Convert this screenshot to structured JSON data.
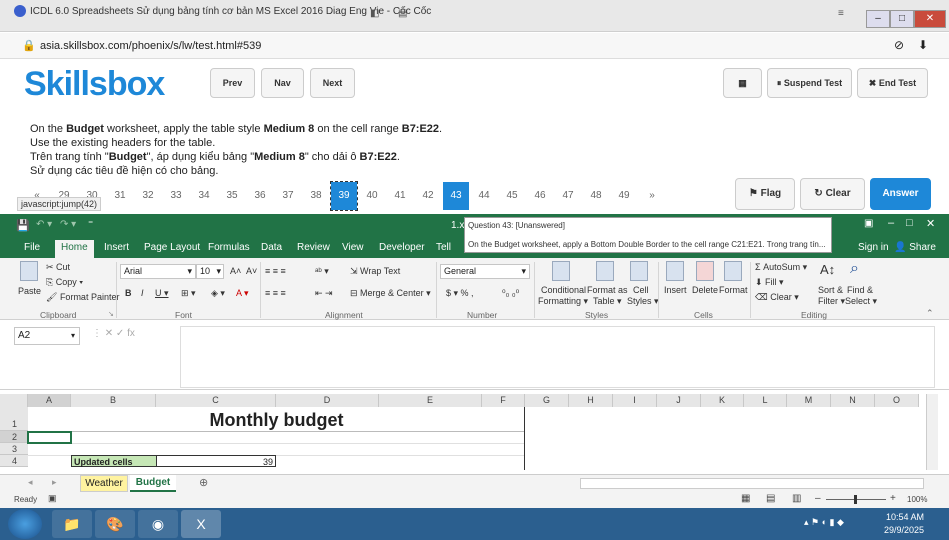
{
  "browser": {
    "title": "ICDL 6.0 Spreadsheets Sử dụng bảng tính cơ bản MS Excel 2016 Diag Eng Vie - Cốc Cốc",
    "url": "asia.skillsbox.com/phoenix/s/lw/test.html#539",
    "status_tip": "javascript:jump(42)"
  },
  "skillsbox": {
    "logo": "Skillsbox",
    "prev": "Prev",
    "nav": "Nav",
    "next": "Next",
    "suspend": "Suspend Test",
    "end": "End Test"
  },
  "question": {
    "en_line1_a": "On the ",
    "en_line1_b": "Budget",
    "en_line1_c": " worksheet, apply the table style ",
    "en_line1_d": "Medium 8",
    "en_line1_e": " on the cell range ",
    "en_line1_f": "B7:E22",
    "en_line1_g": ".",
    "en_line2": "Use the existing headers for the table.",
    "vi_line1_a": "Trên trang tính \"",
    "vi_line1_b": "Budget",
    "vi_line1_c": "\", áp dụng kiểu bảng \"",
    "vi_line1_d": "Medium 8",
    "vi_line1_e": "\" cho dải ô ",
    "vi_line1_f": "B7:E22",
    "vi_line1_g": ".",
    "vi_line2": "Sử dụng các tiêu đề hiện có cho bảng."
  },
  "pager": {
    "pages": [
      "«",
      "29",
      "30",
      "31",
      "32",
      "33",
      "34",
      "35",
      "36",
      "37",
      "38",
      "39",
      "40",
      "41",
      "42",
      "43",
      "44",
      "45",
      "46",
      "47",
      "48",
      "49",
      "»"
    ],
    "flag": "Flag",
    "clear": "Clear",
    "answer": "Answer"
  },
  "excel": {
    "filename": "1.xl",
    "tabs": [
      "File",
      "Home",
      "Insert",
      "Page Layout",
      "Formulas",
      "Data",
      "Review",
      "View",
      "Developer",
      "Tell"
    ],
    "signin": "Sign in",
    "share": "Share",
    "tooltip_title": "Question 43: [Unanswered]",
    "tooltip_body": "On the Budget worksheet, apply a Bottom Double Border to the cell range C21:E21. Trong trang tín...",
    "ribbon": {
      "paste": "Paste",
      "cut": "Cut",
      "copy": "Copy",
      "format_painter": "Format Painter",
      "clipboard": "Clipboard",
      "font_name": "Arial",
      "font_size": "10",
      "font": "Font",
      "wrap": "Wrap Text",
      "merge": "Merge & Center",
      "alignment": "Alignment",
      "numfmt": "General",
      "number": "Number",
      "cond": "Conditional",
      "cond2": "Formatting",
      "fat": "Format as",
      "fat2": "Table",
      "cstyles": "Cell",
      "cstyles2": "Styles",
      "styles": "Styles",
      "insert": "Insert",
      "delete": "Delete",
      "format": "Format",
      "cells": "Cells",
      "autosum": "AutoSum",
      "fill": "Fill",
      "clear": "Clear",
      "sort": "Sort &",
      "sort2": "Filter",
      "find": "Find &",
      "find2": "Select",
      "editing": "Editing"
    },
    "namebox": "A2",
    "columns": [
      "A",
      "B",
      "C",
      "D",
      "E",
      "F",
      "G",
      "H",
      "I",
      "J",
      "K",
      "L",
      "M",
      "N",
      "O"
    ],
    "rows": [
      "1",
      "2",
      "3",
      "4"
    ],
    "sheet_title": "Monthly budget",
    "updated_label": "Updated cells",
    "updated_value": "39",
    "sheets": [
      "Weather",
      "Budget"
    ],
    "status_ready": "Ready",
    "zoom": "100%"
  },
  "taskbar": {
    "time": "10:54 AM",
    "date": "29/9/2025"
  }
}
